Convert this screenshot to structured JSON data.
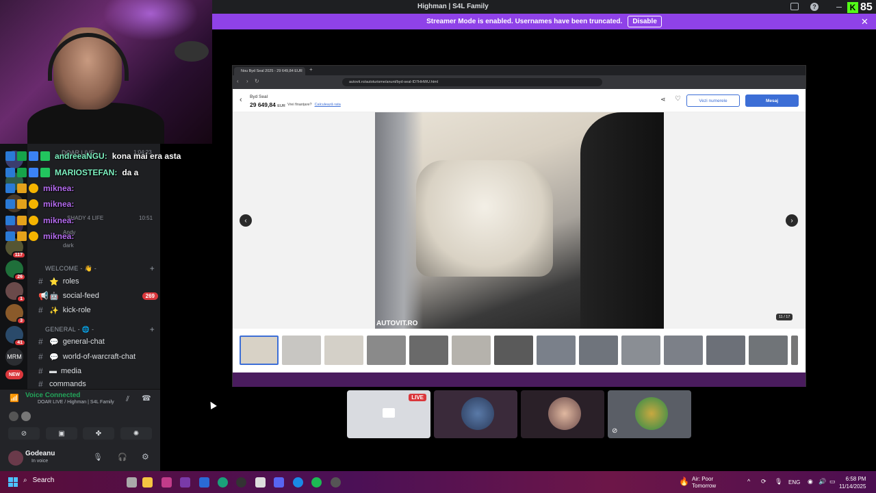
{
  "window": {
    "title": "Highman | S4L Family"
  },
  "kick": {
    "logo_letter": "K",
    "viewers": "85"
  },
  "streamer_mode": {
    "message": "Streamer Mode is enabled. Usernames have been truncated.",
    "disable_label": "Disable"
  },
  "chat": [
    {
      "user": "andreeaNGU:",
      "message": "kona mai era asta",
      "color": "#7df0c0"
    },
    {
      "user": "MARIOSTEFAN:",
      "message": "da a",
      "color": "#7df0c0"
    },
    {
      "user": "mikneа:",
      "message": "",
      "color": "#b56cf0"
    },
    {
      "user": "mikneа:",
      "message": "",
      "color": "#b56cf0"
    },
    {
      "user": "mikneа:",
      "message": "",
      "color": "#b56cf0"
    },
    {
      "user": "mikneа:",
      "message": "",
      "color": "#b56cf0"
    }
  ],
  "voice_members": {
    "channel_header": "DOAR LIVE",
    "time1": "1:04:23",
    "time2": "10:51",
    "members": [
      "SHADY 4 LIFE",
      "Andy",
      "dark"
    ]
  },
  "servers": [
    {
      "label": "",
      "badge": "117"
    },
    {
      "label": "",
      "badge": "26"
    },
    {
      "label": "",
      "badge": "1"
    },
    {
      "label": "",
      "badge": "3"
    },
    {
      "label": "",
      "badge": "41"
    },
    {
      "label": "MRM",
      "badge": ""
    },
    {
      "label": "NEW",
      "badge": ""
    }
  ],
  "categories": {
    "welcome": "WELCOME - 👋 -",
    "general": "GENERAL - 🌐 -"
  },
  "channels": [
    {
      "name": "roles",
      "badge": ""
    },
    {
      "name": "social-feed",
      "badge": "269"
    },
    {
      "name": "kick-role",
      "badge": ""
    },
    {
      "name": "general-chat",
      "badge": ""
    },
    {
      "name": "world-of-warcraft-chat",
      "badge": ""
    },
    {
      "name": "media",
      "badge": ""
    },
    {
      "name": "commands",
      "badge": ""
    }
  ],
  "voice": {
    "status": "Voice Connected",
    "location": "DOAR LIVE / Highman | S4L Family",
    "username": "Godeanu",
    "user_status": "In voice"
  },
  "browser": {
    "tab_title": "Nou Byd Seal 2025 - 29 649,84 EUR",
    "url": "autovit.ro/autoturisme/anunt/byd-seal-ID7HHWU.html",
    "car_name": "Byd Seal",
    "price": "29 649,84",
    "currency": "EUR",
    "finance_q": "Vrei finanțare?",
    "finance_link": "Calculează rata",
    "btn_numbers": "Vezi numerele",
    "btn_message": "Mesaj",
    "watermark": "AUTOVIT.RO",
    "counter": "11 / 17",
    "thumbnail_count": 14
  },
  "participants": {
    "live_label": "LIVE"
  },
  "taskbar": {
    "search": "Search",
    "weather_line1": "Air: Poor",
    "weather_line2": "Tomorrow",
    "lang": "ENG",
    "time": "6:58 PM",
    "date": "11/14/2025"
  },
  "colors": {
    "accent": "#8f42e8",
    "autovit_blue": "#3c6ed6",
    "discord_bg": "#1e1f22",
    "badge_red": "#da373c"
  }
}
